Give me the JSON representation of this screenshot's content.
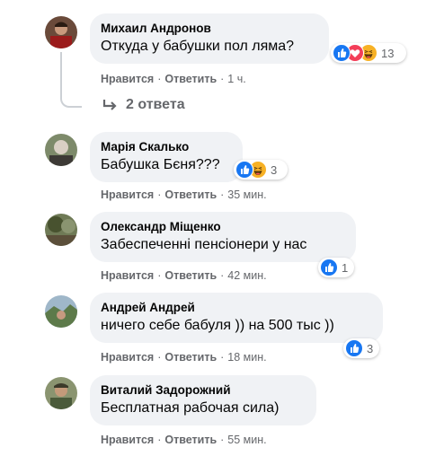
{
  "actions": {
    "like": "Нравится",
    "reply": "Ответить",
    "separator": "·"
  },
  "comments": [
    {
      "author": "Михаил Андронов",
      "text": "Откуда у бабушки пол ляма?",
      "time": "1 ч.",
      "reactions": [
        "like-icon",
        "love-icon",
        "haha-icon"
      ],
      "reaction_count": "13"
    },
    {
      "author": "Марія Скалько",
      "text": "Бабушка Бєня???",
      "time": "35 мин.",
      "reactions": [
        "like-icon",
        "haha-icon"
      ],
      "reaction_count": "3"
    },
    {
      "author": "Олександр Міщенко",
      "text": "Забеспеченні пенсіонери у нас",
      "time": "42 мин.",
      "reactions": [
        "like-icon"
      ],
      "reaction_count": "1"
    },
    {
      "author": "Андрей Андрей",
      "text": "ничего себе бабуля )) на 500 тыс ))",
      "time": "18 мин.",
      "reactions": [
        "like-icon"
      ],
      "reaction_count": "3"
    },
    {
      "author": "Виталий Задорожний",
      "text": "Бесплатная рабочая сила)",
      "time": "55 мин.",
      "reactions": [],
      "reaction_count": ""
    }
  ],
  "replies_link": {
    "label": "2 ответа",
    "icon": "reply-arrow-icon"
  },
  "colors": {
    "like": "#1877f2",
    "love": "#f33e58",
    "haha": "#f7b125",
    "bubble": "#f0f2f5",
    "meta": "#65676b"
  }
}
